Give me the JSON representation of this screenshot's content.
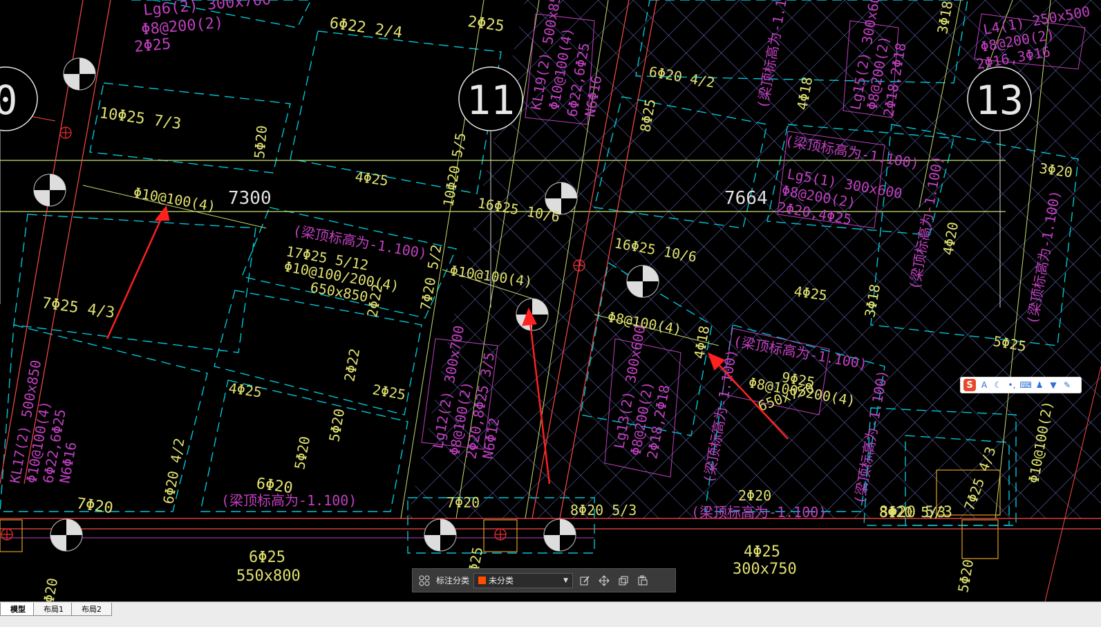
{
  "drawing": {
    "axes": [
      "0",
      "11",
      "13"
    ],
    "dims": [
      "7300",
      "7664"
    ],
    "beam_labels": [
      "Lg6(2) 300x700",
      "Φ8@200(2)",
      "2Φ25",
      "6Φ22 2/4",
      "2Φ25",
      "10Φ25 7/3",
      "5Φ20",
      "4Φ25",
      "Φ10@100(4)",
      "10Φ20 5/5",
      "16Φ25 10/6",
      "(梁顶标高为-1.100)",
      "17Φ25 5/12",
      "Φ10@100/200(4)",
      "650x850",
      "2Φ22",
      "7Φ20 5/2",
      "Φ10@100(4)",
      "7Φ25 4/3",
      "2Φ22",
      "2Φ25",
      "4Φ25",
      "5Φ20",
      "6Φ20",
      "5Φ20",
      "6Φ20 4/2",
      "7Φ20",
      "(梁顶标高为-1.100)",
      "7Φ20",
      "KL17(2) 500x850",
      "Φ10@100(4)",
      "6Φ22,6Φ25",
      "N6Φ16",
      "KL19(2) 500x850",
      "Φ10@100(4)",
      "6Φ22,6Φ25",
      "N6Φ16",
      "Lg12(2) 300x700",
      "Φ8@100(2)",
      "2Φ20,8Φ25 3/5",
      "N6Φ12",
      "8Φ25",
      "6Φ20 4/2",
      "16Φ25 10/6",
      "Φ8@100(4)",
      "Lg13(2) 300x600",
      "Φ8@200(2)",
      "2Φ18,2Φ18",
      "4Φ18",
      "(梁顶标高为-1.100)",
      "9Φ25",
      "Φ8@100/200(4)",
      "650x750",
      "(梁顶标高为-1.100)",
      "2Φ20",
      "(梁顶标高为-1.100)",
      "8Φ20 5/3",
      "4Φ18",
      "(梁顶标高为-1.100)",
      "Lg15(2) 300x600",
      "Φ8@200(2)",
      "2Φ18,2Φ18",
      "(梁顶标高为-1.100)",
      "Lg5(1) 300x600",
      "Φ8@200(2)",
      "2Φ20,4Φ25",
      "4Φ25",
      "3Φ18",
      "3Φ18",
      "(梁顶标高为-1.100)",
      "4Φ20",
      "3Φ20",
      "(梁顶标高为-1.100)",
      "5Φ25",
      "L4(1) 250x500",
      "Φ8@200(2)",
      "2Φ16,3Φ16",
      "(梁顶标高为-1.100)",
      "7Φ25 4/3",
      "8Φ20 5/3",
      "Φ10@100(2)",
      "6Φ25",
      "550x800",
      "8Φ20 5/3",
      "4Φ25",
      "300x750",
      "5Φ20",
      "2Φ25",
      "2Φ20"
    ]
  },
  "annotation_toolbar": {
    "category_label": "标注分类",
    "category_value": "未分类",
    "category_color": "#ff4d00"
  },
  "ime_toolbar": {
    "logo": "S"
  },
  "tabs": {
    "items": [
      {
        "label": "模型",
        "active": true
      },
      {
        "label": "布局1",
        "active": false
      },
      {
        "label": "布局2",
        "active": false
      }
    ]
  },
  "colors": {
    "background": "#000000",
    "beam_edge": "#00c8d8",
    "text_yellow": "#e0e070",
    "text_magenta": "#c040c0",
    "axis_green": "#c8e070",
    "red": "#ff2020",
    "hatch": "#8fa0ff"
  }
}
